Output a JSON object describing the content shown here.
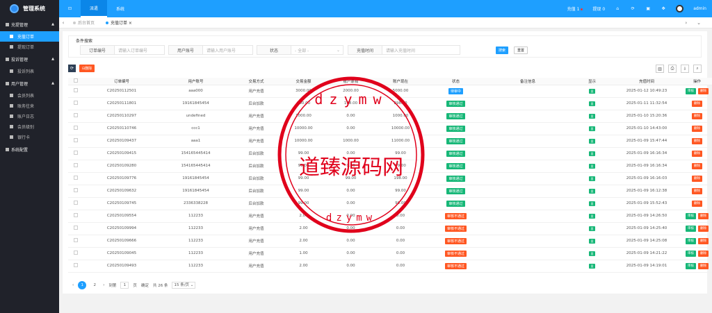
{
  "app": {
    "title": "管理系统"
  },
  "topnav": [
    "⊡",
    "派遣",
    "系统"
  ],
  "topright": {
    "recharge": "充值",
    "recharge_count": "1",
    "withdraw": "提现",
    "withdraw_count": "0",
    "user": "admin"
  },
  "sidebar": {
    "groups": [
      {
        "label": "充提管理",
        "items": [
          "充值订单",
          "提现订单"
        ]
      },
      {
        "label": "投诉管理",
        "items": [
          "投诉列表"
        ]
      },
      {
        "label": "用户管理",
        "items": [
          "会员列表",
          "账务往来",
          "账户日志",
          "会员级别",
          "银行卡"
        ]
      },
      {
        "label": "系统配置",
        "items": []
      }
    ]
  },
  "tabs": [
    "后台首页",
    "充值订单 ×"
  ],
  "filter": {
    "legend": "条件搜索",
    "fields": [
      {
        "label": "订单编号",
        "placeholder": "请输入订单编号"
      },
      {
        "label": "用户账号",
        "placeholder": "请输入用户账号"
      },
      {
        "label": "状态",
        "placeholder": "- 全部 -"
      },
      {
        "label": "充值时间",
        "placeholder": "请输入充值时间"
      }
    ],
    "search": "搜索",
    "reset": "重置"
  },
  "toolbar": {
    "delete": "删除"
  },
  "table": {
    "headers": [
      "",
      "订单编号",
      "用户账号",
      "交易方式",
      "交易金额",
      "账户原有",
      "账户现在",
      "状态",
      "备注信息",
      "显示",
      "充值时间",
      "操作"
    ],
    "rows": [
      [
        "C20250112501",
        "aaa000",
        "用户充值",
        "3000.00",
        "2000.00",
        "5000.00",
        "待审中",
        "",
        "显",
        "2025-01-12 10:49:23",
        "both"
      ],
      [
        "C20250111801",
        "19161845454",
        "后台加款",
        "100.00",
        "198.00",
        "298.00",
        "审核通过",
        "",
        "显",
        "2025-01-11 11:32:54",
        "del"
      ],
      [
        "C20250110297",
        "undefined",
        "用户充值",
        "1000.00",
        "0.00",
        "1000.00",
        "审核通过",
        "",
        "显",
        "2025-01-10 15:20:36",
        "del"
      ],
      [
        "C20250110746",
        "ccc1",
        "用户充值",
        "10000.00",
        "0.00",
        "10000.00",
        "审核通过",
        "",
        "显",
        "2025-01-10 14:43:00",
        "del"
      ],
      [
        "C20250109437",
        "aaa1",
        "用户充值",
        "10000.00",
        "1000.00",
        "11000.00",
        "审核通过",
        "",
        "显",
        "2025-01-09 15:47:44",
        "del"
      ],
      [
        "C20250109415",
        "154165445414",
        "后台加款",
        "99.00",
        "0.00",
        "99.00",
        "审核通过",
        "",
        "显",
        "2025-01-09 16:16:34",
        "del"
      ],
      [
        "C20250109280",
        "154165445414",
        "后台加款",
        "99.00",
        "0.00",
        "99.00",
        "审核通过",
        "",
        "显",
        "2025-01-09 16:16:34",
        "del"
      ],
      [
        "C20250109776",
        "19161845454",
        "后台加款",
        "99.00",
        "99.00",
        "198.00",
        "审核通过",
        "",
        "显",
        "2025-01-09 16:16:03",
        "del"
      ],
      [
        "C20250109632",
        "19161845454",
        "后台加款",
        "99.00",
        "0.00",
        "99.00",
        "审核通过",
        "",
        "显",
        "2025-01-09 16:12:38",
        "del"
      ],
      [
        "C20250109745",
        "2336338228",
        "后台加款",
        "99.00",
        "0.00",
        "99.00",
        "审核通过",
        "",
        "显",
        "2025-01-09 15:52:43",
        "del"
      ],
      [
        "C20250109554",
        "112233",
        "用户充值",
        "2.00",
        "0.00",
        "0.00",
        "审核不通过",
        "",
        "显",
        "2025-01-09 14:26:50",
        "both"
      ],
      [
        "C20250109994",
        "112233",
        "用户充值",
        "2.00",
        "0.00",
        "0.00",
        "审核不通过",
        "",
        "显",
        "2025-01-09 14:25:40",
        "both"
      ],
      [
        "C20250109666",
        "112233",
        "用户充值",
        "2.00",
        "0.00",
        "0.00",
        "审核不通过",
        "",
        "显",
        "2025-01-09 14:25:08",
        "both"
      ],
      [
        "C20250109045",
        "112233",
        "用户充值",
        "1.00",
        "0.00",
        "0.00",
        "审核不通过",
        "",
        "显",
        "2025-01-09 14:21:22",
        "both"
      ],
      [
        "C20250109493",
        "112233",
        "用户充值",
        "2.00",
        "0.00",
        "0.00",
        "审核不通过",
        "",
        "显",
        "2025-01-09 14:19:01",
        "both"
      ]
    ],
    "ops": {
      "audit": "审核",
      "del": "删除"
    }
  },
  "pager": {
    "pages": [
      "1",
      "2"
    ],
    "goto": "到第",
    "page_value": "1",
    "page_suffix": "页",
    "confirm": "确定",
    "total": "共 26 条",
    "size": "15 条/页"
  },
  "watermark": {
    "main": "道臻源码网",
    "ring_top": "dzymw",
    "ring_bottom": "dzymw"
  },
  "colors": {
    "primary": "#1e9fff",
    "sidebar": "#20222a",
    "pending": "#1e9fff",
    "pass": "#16b777",
    "fail": "#ff5722",
    "stamp": "#e0001b"
  }
}
